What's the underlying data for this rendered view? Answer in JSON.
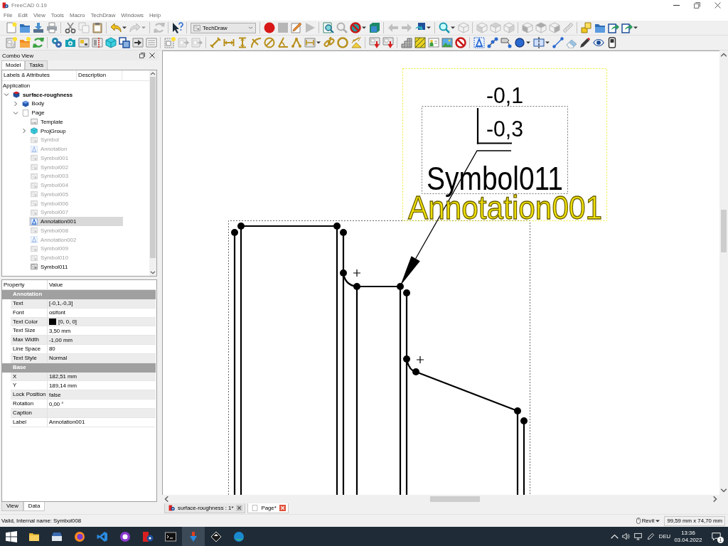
{
  "window": {
    "title": "FreeCAD 0.19"
  },
  "menu": [
    "File",
    "Edit",
    "View",
    "Tools",
    "Macro",
    "TechDraw",
    "Windows",
    "Help"
  ],
  "toolbar_rows": [
    [
      [
        {
          "kind": "plain",
          "disabled": false
        },
        {
          "kind": "plain",
          "disabled": false
        },
        {
          "kind": "plain",
          "disabled": false
        },
        {
          "kind": "plain",
          "disabled": false
        }
      ],
      [
        {
          "kind": "plain",
          "disabled": false
        },
        {
          "kind": "plain",
          "disabled": true
        },
        {
          "kind": "plain",
          "disabled": false
        }
      ],
      [
        {
          "kind": "menu",
          "disabled": false
        },
        {
          "kind": "menu",
          "disabled": true
        }
      ],
      [
        {
          "kind": "plain",
          "disabled": true
        }
      ],
      [
        {
          "kind": "plain",
          "disabled": false
        }
      ],
      [
        {
          "kind": "combo",
          "value": "TechDraw"
        }
      ],
      [
        {
          "kind": "plain",
          "disabled": false
        },
        {
          "kind": "plain",
          "disabled": true
        },
        {
          "kind": "plain",
          "disabled": false
        },
        {
          "kind": "plain",
          "disabled": true
        }
      ],
      [
        {
          "kind": "plain",
          "disabled": false
        },
        {
          "kind": "plain",
          "disabled": true
        },
        {
          "kind": "menu",
          "disabled": false
        },
        {
          "kind": "plain",
          "disabled": false
        }
      ],
      [
        {
          "kind": "plain",
          "disabled": true
        },
        {
          "kind": "plain",
          "disabled": true
        },
        {
          "kind": "menu",
          "disabled": false
        }
      ],
      [
        {
          "kind": "menu",
          "disabled": false
        },
        {
          "kind": "plain",
          "disabled": true
        }
      ],
      [
        {
          "kind": "plain",
          "disabled": true
        },
        {
          "kind": "plain",
          "disabled": true
        },
        {
          "kind": "plain",
          "disabled": true
        }
      ],
      [
        {
          "kind": "plain",
          "disabled": true
        },
        {
          "kind": "plain",
          "disabled": true
        },
        {
          "kind": "plain",
          "disabled": true
        },
        {
          "kind": "plain",
          "disabled": true
        }
      ],
      [
        {
          "kind": "plain",
          "disabled": false
        },
        {
          "kind": "plain",
          "disabled": false
        },
        {
          "kind": "plain",
          "disabled": false
        },
        {
          "kind": "menu",
          "disabled": false
        }
      ]
    ],
    [
      [
        {
          "kind": "plain",
          "disabled": false
        },
        {
          "kind": "plain",
          "disabled": false
        },
        {
          "kind": "plain",
          "disabled": false
        }
      ],
      [
        {
          "kind": "plain",
          "disabled": false
        },
        {
          "kind": "plain",
          "disabled": false
        },
        {
          "kind": "plain",
          "disabled": false
        },
        {
          "kind": "plain",
          "disabled": false
        },
        {
          "kind": "plain",
          "disabled": false
        },
        {
          "kind": "plain",
          "disabled": false
        },
        {
          "kind": "plain",
          "disabled": false
        },
        {
          "kind": "plain",
          "disabled": false
        }
      ],
      [
        {
          "kind": "plain",
          "disabled": false
        },
        {
          "kind": "plain",
          "disabled": true
        },
        {
          "kind": "plain",
          "disabled": true
        }
      ],
      [
        {
          "kind": "plain",
          "disabled": false
        },
        {
          "kind": "plain",
          "disabled": false
        },
        {
          "kind": "plain",
          "disabled": false
        },
        {
          "kind": "plain",
          "disabled": false
        },
        {
          "kind": "plain",
          "disabled": false
        },
        {
          "kind": "plain",
          "disabled": false
        },
        {
          "kind": "plain",
          "disabled": false
        },
        {
          "kind": "menu",
          "disabled": false
        },
        {
          "kind": "plain",
          "disabled": false
        },
        {
          "kind": "plain",
          "disabled": false
        },
        {
          "kind": "plain",
          "disabled": false
        }
      ],
      [
        {
          "kind": "plain",
          "disabled": false
        },
        {
          "kind": "plain",
          "disabled": false
        }
      ],
      [
        {
          "kind": "plain",
          "disabled": false
        },
        {
          "kind": "plain",
          "disabled": false
        },
        {
          "kind": "plain",
          "disabled": false
        },
        {
          "kind": "plain",
          "disabled": false
        },
        {
          "kind": "plain",
          "disabled": false
        }
      ],
      [
        {
          "kind": "plain",
          "disabled": false
        },
        {
          "kind": "plain",
          "disabled": false
        },
        {
          "kind": "plain",
          "disabled": false
        },
        {
          "kind": "menu",
          "disabled": false
        },
        {
          "kind": "menu",
          "disabled": false
        },
        {
          "kind": "plain",
          "disabled": false
        },
        {
          "kind": "plain",
          "disabled": false
        },
        {
          "kind": "plain",
          "disabled": false
        },
        {
          "kind": "plain",
          "disabled": false
        },
        {
          "kind": "plain",
          "disabled": false
        }
      ]
    ]
  ],
  "combo_view": {
    "title": "Combo View",
    "tabs": [
      {
        "label": "Model",
        "selected": true
      },
      {
        "label": "Tasks",
        "selected": false
      }
    ],
    "tree": {
      "columns": [
        "Labels & Attributes",
        "Description"
      ],
      "root": "Application",
      "items": [
        {
          "label": "surface-roughness",
          "kind": "document",
          "visible": true,
          "selected": false,
          "expanded": true,
          "children": [
            {
              "label": "Body",
              "kind": "body",
              "visible": true,
              "selected": false,
              "expanded": false
            },
            {
              "label": "Page",
              "kind": "page",
              "visible": true,
              "selected": false,
              "expanded": true,
              "children": [
                {
                  "label": "Template",
                  "kind": "template",
                  "visible": true,
                  "selected": false
                },
                {
                  "label": "ProjGroup",
                  "kind": "projgroup",
                  "visible": true,
                  "selected": false,
                  "expanded": false
                },
                {
                  "label": "Symbol",
                  "kind": "symbol",
                  "visible": false,
                  "selected": false
                },
                {
                  "label": "Annotation",
                  "kind": "annotation",
                  "visible": false,
                  "selected": false
                },
                {
                  "label": "Symbol001",
                  "kind": "symbol",
                  "visible": false,
                  "selected": false
                },
                {
                  "label": "Symbol002",
                  "kind": "symbol",
                  "visible": false,
                  "selected": false
                },
                {
                  "label": "Symbol003",
                  "kind": "symbol",
                  "visible": false,
                  "selected": false
                },
                {
                  "label": "Symbol004",
                  "kind": "symbol",
                  "visible": false,
                  "selected": false
                },
                {
                  "label": "Symbol005",
                  "kind": "symbol",
                  "visible": false,
                  "selected": false
                },
                {
                  "label": "Symbol006",
                  "kind": "symbol",
                  "visible": false,
                  "selected": false
                },
                {
                  "label": "Symbol007",
                  "kind": "symbol",
                  "visible": false,
                  "selected": false
                },
                {
                  "label": "Annotation001",
                  "kind": "annotation",
                  "visible": true,
                  "selected": true
                },
                {
                  "label": "Symbol008",
                  "kind": "symbol",
                  "visible": false,
                  "selected": false
                },
                {
                  "label": "Annotation002",
                  "kind": "annotation",
                  "visible": false,
                  "selected": false
                },
                {
                  "label": "Symbol009",
                  "kind": "symbol",
                  "visible": false,
                  "selected": false
                },
                {
                  "label": "Symbol010",
                  "kind": "symbol",
                  "visible": false,
                  "selected": false
                },
                {
                  "label": "Symbol011",
                  "kind": "symbol",
                  "visible": true,
                  "selected": false
                }
              ]
            }
          ]
        }
      ]
    }
  },
  "property_view": {
    "columns": [
      "Property",
      "Value"
    ],
    "rows": [
      {
        "kind": "group",
        "label": "Annotation"
      },
      {
        "kind": "text",
        "name": "Text",
        "value": "[-0,1,-0,3]"
      },
      {
        "kind": "text",
        "name": "Font",
        "value": "osifont"
      },
      {
        "kind": "color",
        "name": "Text Color",
        "value": "[0, 0, 0]",
        "color": "#000000"
      },
      {
        "kind": "text",
        "name": "Text Size",
        "value": "3,50 mm"
      },
      {
        "kind": "text",
        "name": "Max Width",
        "value": "-1,00 mm"
      },
      {
        "kind": "text",
        "name": "Line Space",
        "value": "80"
      },
      {
        "kind": "text",
        "name": "Text Style",
        "value": "Normal"
      },
      {
        "kind": "group",
        "label": "Base"
      },
      {
        "kind": "text",
        "name": "X",
        "value": "182,51 mm"
      },
      {
        "kind": "text",
        "name": "Y",
        "value": "189,14 mm"
      },
      {
        "kind": "text",
        "name": "Lock Position",
        "value": "false"
      },
      {
        "kind": "text",
        "name": "Rotation",
        "value": "0,00 °"
      },
      {
        "kind": "text",
        "name": "Caption"
      },
      {
        "kind": "text",
        "name": "Label",
        "value": "Annotation001"
      }
    ],
    "tabs": [
      {
        "label": "View",
        "selected": false
      },
      {
        "label": "Data",
        "selected": true
      }
    ]
  },
  "drawing": {
    "annotation": {
      "lines": [
        "-0,1",
        "-0,3"
      ],
      "label": "Annotation001",
      "selected": true
    },
    "symbol": {
      "label": "Symbol011"
    }
  },
  "document_tabs": [
    {
      "label": "surface-roughness : 1*",
      "kind": "document",
      "selected": false
    },
    {
      "label": "Page*",
      "kind": "page",
      "selected": true
    }
  ],
  "status_bar": {
    "message": "Valid, Internal name: Symbol008",
    "navigation": "Revit",
    "page_size": "99,59 mm x 74,70 mm"
  },
  "taskbar": {
    "apps": [
      {
        "active": false
      },
      {
        "active": false
      },
      {
        "active": false
      },
      {
        "active": false
      },
      {
        "active": false
      },
      {
        "active": false
      },
      {
        "active": false
      },
      {
        "active": true
      },
      {
        "active": false
      },
      {
        "active": false
      }
    ],
    "language": "DEU",
    "time": "13:36",
    "date": "03.04.2022",
    "notifications": "1"
  }
}
